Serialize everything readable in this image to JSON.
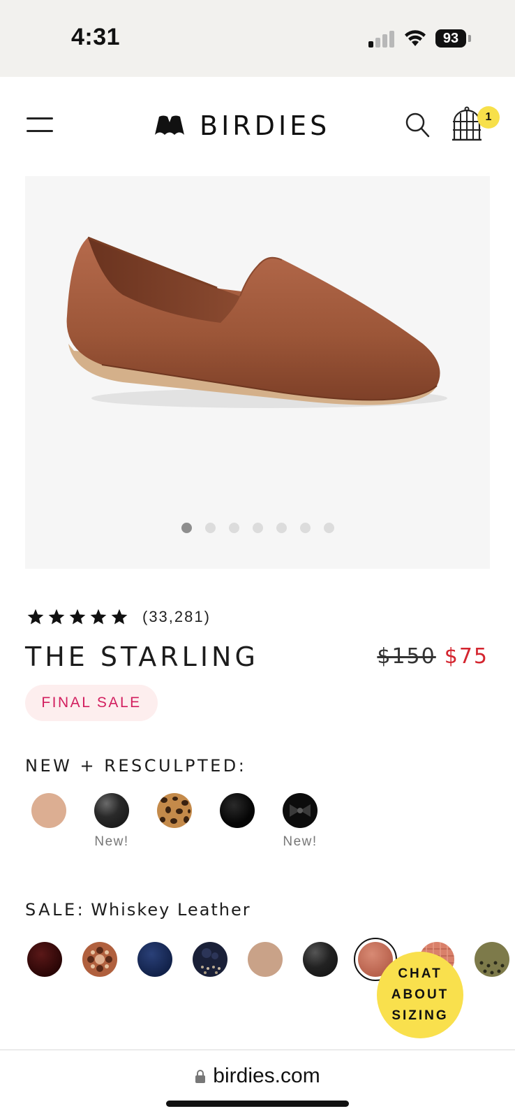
{
  "status_bar": {
    "time": "4:31",
    "battery": "93"
  },
  "header": {
    "brand": "BIRDIES",
    "cart_count": "1"
  },
  "gallery": {
    "image": "whiskey-leather-loafer",
    "slide_count": 7,
    "active_slide": 1
  },
  "product": {
    "rating_stars": 5,
    "review_count": "(33,281)",
    "title": "THE STARLING",
    "price_original": "$150",
    "price_sale": "$75",
    "badge": "FINAL SALE"
  },
  "new_section": {
    "heading": "NEW + RESCULPTED:",
    "labels": [
      "New!",
      "New!"
    ],
    "swatches": [
      {
        "color": "#dcae92"
      },
      {
        "color": "#1e1e1e",
        "label": "New!"
      },
      {
        "color": "#b47a3e",
        "pattern": "leopard"
      },
      {
        "color": "#050505"
      },
      {
        "color": "#111111",
        "pattern": "bow",
        "label": "New!"
      }
    ]
  },
  "sale_section": {
    "heading": "SALE:",
    "selected_color": "Whiskey Leather",
    "swatches": [
      {
        "color": "#3a0b0b"
      },
      {
        "color": "#a85a3a",
        "pattern": "floral"
      },
      {
        "color": "#152a5a"
      },
      {
        "color": "#1a2038",
        "pattern": "embellished"
      },
      {
        "color": "#c9a288"
      },
      {
        "color": "#1d1d1d"
      },
      {
        "color": "#c8725e",
        "selected": true
      },
      {
        "color": "#d9806a",
        "pattern": "woven"
      },
      {
        "color": "#7d7a4a",
        "pattern": "dotted"
      }
    ]
  },
  "chat": {
    "line1": "CHAT",
    "line2": "ABOUT",
    "line3": "SIZING"
  },
  "browser": {
    "url": "birdies.com"
  },
  "colors": {
    "sale_red": "#d4252f",
    "badge_pink": "#d21f5f",
    "chat_yellow": "#f9e04d"
  }
}
